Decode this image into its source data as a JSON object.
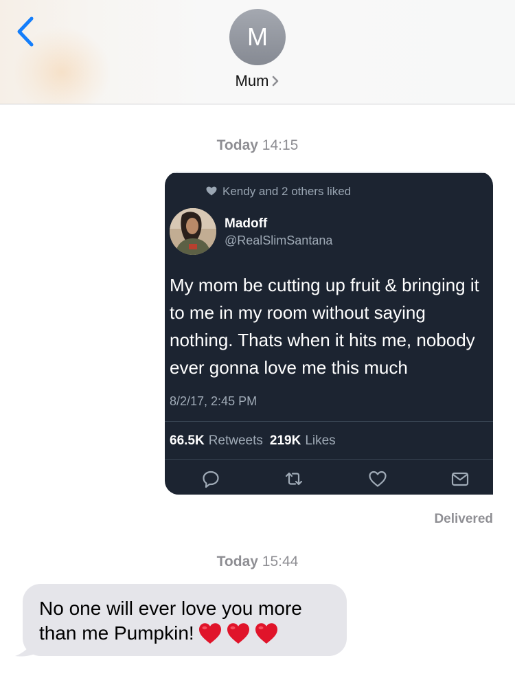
{
  "header": {
    "contact_initial": "M",
    "contact_name": "Mum"
  },
  "thread": {
    "timestamp_1": {
      "day": "Today",
      "time": "14:15"
    },
    "timestamp_2": {
      "day": "Today",
      "time": "15:44"
    },
    "delivered_label": "Delivered"
  },
  "tweet": {
    "liked_by": "Kendy and 2 others liked",
    "author_name": "Madoff",
    "author_handle": "@RealSlimSantana",
    "text_lines": [
      "My mom be cutting up fruit & bringing it",
      "to me in my room without saying",
      "nothing. Thats when it hits me, nobody",
      "ever gonna love me this much"
    ],
    "date": "8/2/17, 2:45 PM",
    "retweets_count": "66.5K",
    "retweets_label": "Retweets",
    "likes_count": "219K",
    "likes_label": "Likes",
    "action_icons": [
      "reply-icon",
      "retweet-icon",
      "like-icon",
      "share-icon"
    ]
  },
  "incoming_message": {
    "text_line_1": "No one will ever love you more",
    "text_line_2": "than me Pumpkin!",
    "emoji": [
      "red-heart",
      "red-heart",
      "red-heart"
    ]
  },
  "colors": {
    "ios_blue": "#147efb",
    "avatar_gray": "#8e9299",
    "tweet_bg": "#1c2431",
    "incoming_bubble": "#e5e5ea",
    "meta_gray": "#8e8e93",
    "heart_red": "#e0142a"
  }
}
